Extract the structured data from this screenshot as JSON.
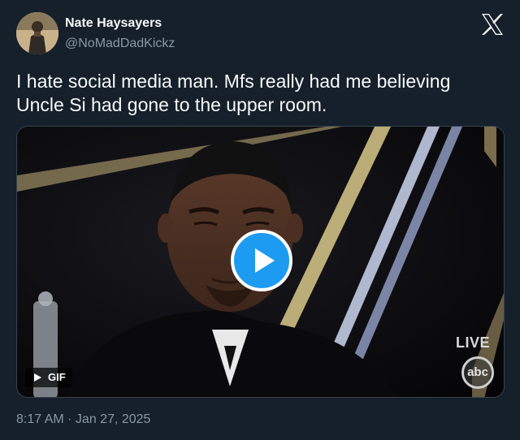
{
  "author": {
    "name": "Nate Haysayers",
    "handle": "@NoMadDadKickz"
  },
  "tweet": {
    "text": "I hate social media man. Mfs really had me believing Uncle Si had gone to the upper room."
  },
  "media": {
    "badge_label": "GIF",
    "overlay_live": "LIVE",
    "overlay_network": "abc"
  },
  "meta": {
    "timestamp": "8:17 AM · Jan 27, 2025"
  },
  "colors": {
    "background": "#15202b",
    "text_primary": "#f7f9f9",
    "text_secondary": "#8b98a5",
    "accent": "#1d9bf0"
  },
  "icons": {
    "brand": "x-logo-icon",
    "play": "play-icon",
    "gif_play": "play-triangle-icon"
  }
}
